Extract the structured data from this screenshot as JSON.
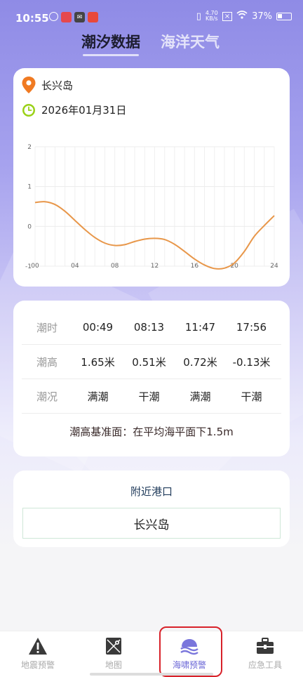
{
  "status": {
    "time": "10:55",
    "net_speed_top": "4.70",
    "net_speed_bottom": "KB/s",
    "battery": "37%"
  },
  "tabs": [
    {
      "label": "潮汐数据",
      "active": true
    },
    {
      "label": "海洋天气",
      "active": false
    }
  ],
  "location": {
    "name": "长兴岛",
    "date": "2026年01月31日"
  },
  "icons": {
    "location": "location-pin-icon",
    "date": "clock-icon"
  },
  "colors": {
    "accent": "#6a66d6",
    "curve": "#e8974a",
    "pin": "#f07a22",
    "clock": "#9ad117"
  },
  "chart_data": {
    "type": "line",
    "x_ticks": [
      "00",
      "04",
      "08",
      "12",
      "16",
      "20",
      "24"
    ],
    "y_ticks": [
      "2",
      "1",
      "0",
      "-1"
    ],
    "xlim": [
      0,
      24
    ],
    "ylim": [
      -1,
      2
    ],
    "grid": true,
    "series": [
      {
        "x": [
          0,
          1,
          2,
          3,
          4,
          5,
          6,
          7,
          8,
          9,
          10,
          11,
          12,
          13,
          14,
          15,
          16,
          17,
          18,
          19,
          20,
          21,
          22,
          23,
          24
        ],
        "y": [
          0.6,
          0.62,
          0.55,
          0.38,
          0.15,
          -0.08,
          -0.28,
          -0.42,
          -0.48,
          -0.46,
          -0.38,
          -0.32,
          -0.3,
          -0.33,
          -0.45,
          -0.63,
          -0.82,
          -0.97,
          -1.06,
          -1.05,
          -0.92,
          -0.63,
          -0.25,
          0.02,
          0.27
        ]
      }
    ]
  },
  "tide_table": {
    "rows": [
      {
        "label": "潮时",
        "cells": [
          "00:49",
          "08:13",
          "11:47",
          "17:56"
        ]
      },
      {
        "label": "潮高",
        "cells": [
          "1.65米",
          "0.51米",
          "0.72米",
          "-0.13米"
        ]
      },
      {
        "label": "潮况",
        "cells": [
          "满潮",
          "干潮",
          "满潮",
          "干潮"
        ]
      }
    ],
    "datum": "潮高基准面：在平均海平面下1.5m"
  },
  "port": {
    "title": "附近港口",
    "name": "长兴岛"
  },
  "nav": [
    {
      "label": "地震预警",
      "icon": "warning-icon",
      "active": false
    },
    {
      "label": "地图",
      "icon": "map-icon",
      "active": false
    },
    {
      "label": "海啸预警",
      "icon": "tsunami-wave-icon",
      "active": true
    },
    {
      "label": "应急工具",
      "icon": "toolbox-icon",
      "active": false
    }
  ]
}
